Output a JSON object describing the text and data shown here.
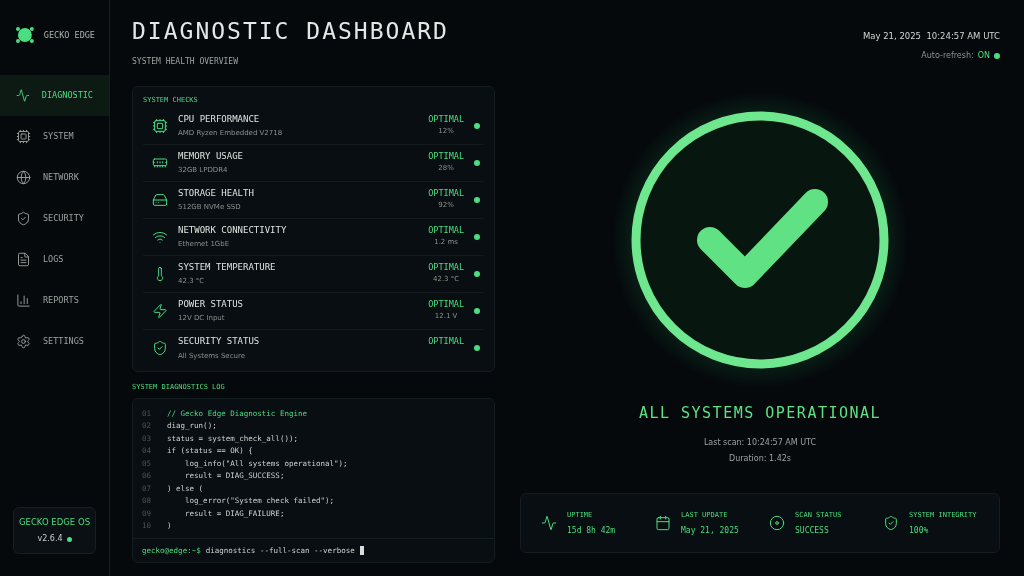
{
  "brand": {
    "name": "GECKO EDGE"
  },
  "sidebar": {
    "items": [
      {
        "label": "DIAGNOSTIC",
        "selected": true
      },
      {
        "label": "SYSTEM",
        "selected": false
      },
      {
        "label": "NETWORK",
        "selected": false
      },
      {
        "label": "SECURITY",
        "selected": false
      },
      {
        "label": "LOGS",
        "selected": false
      },
      {
        "label": "REPORTS",
        "selected": false
      },
      {
        "label": "SETTINGS",
        "selected": false
      }
    ],
    "os_badge": {
      "name": "GECKO EDGE OS",
      "version": "v2.6.4"
    }
  },
  "header": {
    "title": "DIAGNOSTIC DASHBOARD",
    "subtitle": "SYSTEM HEALTH OVERVIEW",
    "datetime": "May 21, 2025  10:24:57 AM UTC",
    "auto_refresh_label": "Auto-refresh:",
    "auto_refresh_value": "ON"
  },
  "system_checks": {
    "title": "SYSTEM CHECKS",
    "rows": [
      {
        "name": "CPU PERFORMANCE",
        "detail": "AMD Ryzen Embedded V2718",
        "status": "OPTIMAL",
        "reading": "12%"
      },
      {
        "name": "MEMORY USAGE",
        "detail": "32GB LPDDR4",
        "status": "OPTIMAL",
        "reading": "28%"
      },
      {
        "name": "STORAGE HEALTH",
        "detail": "512GB NVMe SSD",
        "status": "OPTIMAL",
        "reading": "92%"
      },
      {
        "name": "NETWORK CONNECTIVITY",
        "detail": "Ethernet 1GbE",
        "status": "OPTIMAL",
        "reading": "1.2 ms"
      },
      {
        "name": "SYSTEM TEMPERATURE",
        "detail": "42.3 °C",
        "status": "OPTIMAL",
        "reading": "42.3 °C"
      },
      {
        "name": "POWER STATUS",
        "detail": "12V DC Input",
        "status": "OPTIMAL",
        "reading": "12.1 V"
      },
      {
        "name": "SECURITY STATUS",
        "detail": "All Systems Secure",
        "status": "OPTIMAL"
      }
    ]
  },
  "log": {
    "title": "SYSTEM DIAGNOSTICS LOG",
    "lines": [
      {
        "number": "01",
        "kind": "comment",
        "text": "// Gecko Edge Diagnostic Engine"
      },
      {
        "number": "02",
        "kind": "code",
        "text": "diag_run();"
      },
      {
        "number": "03",
        "kind": "code",
        "text": "status = system_check_all());"
      },
      {
        "number": "04",
        "kind": "code",
        "text": "if (status == OK) {"
      },
      {
        "number": "05",
        "kind": "code",
        "text": "    log_info(\"All systems operational\");"
      },
      {
        "number": "06",
        "kind": "code",
        "text": "    result = DIAG_SUCCESS;"
      },
      {
        "number": "07",
        "kind": "code",
        "text": ") else ("
      },
      {
        "number": "08",
        "kind": "code",
        "text": "    log_error(\"System check failed\");"
      },
      {
        "number": "09",
        "kind": "code",
        "text": "    result = DIAG_FAILURE;"
      },
      {
        "number": "10",
        "kind": "code",
        "text": ")"
      }
    ],
    "prompt": "gecko@edge:~$",
    "command": "diagnostics --full-scan --verbose"
  },
  "status": {
    "headline": "ALL SYSTEMS OPERATIONAL",
    "last_scan": "Last scan: 10:24:57 AM UTC",
    "duration": "Duration: 1.42s"
  },
  "stats": [
    {
      "label": "UPTIME",
      "value": "15d 8h 42m"
    },
    {
      "label": "LAST UPDATE",
      "value": "May 21, 2025"
    },
    {
      "label": "SCAN STATUS",
      "value": "SUCCESS"
    },
    {
      "label": "SYSTEM INTEGRITY",
      "value": "100%"
    }
  ]
}
